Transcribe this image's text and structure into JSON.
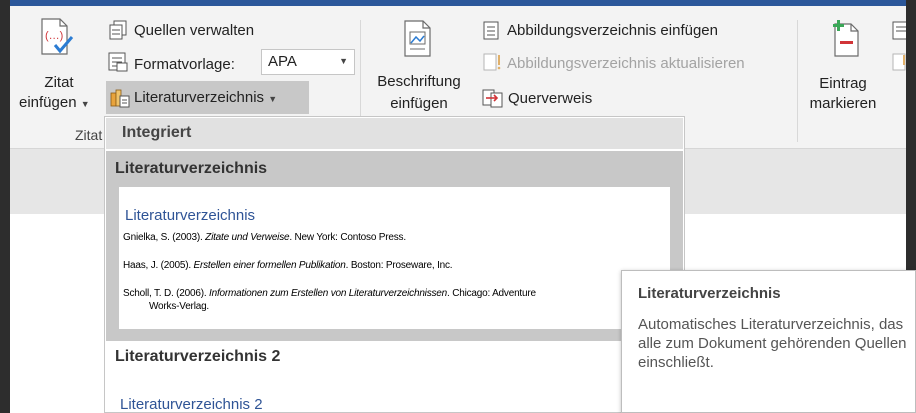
{
  "ribbon": {
    "citation_group": {
      "insert_citation": "Zitat\neinfügen",
      "insert_citation_line1": "Zitat",
      "insert_citation_line2": "einfügen",
      "manage_sources": "Quellen verwalten",
      "style_label": "Formatvorlage:",
      "style_value": "APA",
      "bibliography": "Literaturverzeichnis",
      "group_label": "Zitat"
    },
    "captions_group": {
      "insert_caption_line1": "Beschriftung",
      "insert_caption_line2": "einfügen",
      "insert_table_of_figures": "Abbildungsverzeichnis einfügen",
      "update_table": "Abbildungsverzeichnis aktualisieren",
      "cross_reference": "Querverweis"
    },
    "index_group": {
      "mark_entry_line1": "Eintrag",
      "mark_entry_line2": "markieren"
    }
  },
  "dropdown": {
    "section_header": "Integriert",
    "items": [
      {
        "title": "Literaturverzeichnis",
        "preview_heading": "Literaturverzeichnis",
        "references": [
          {
            "prefix": "Gnielka, S. (2003). ",
            "italic": "Zitate und Verweise",
            "suffix": ". New York: Contoso Press."
          },
          {
            "prefix": "Haas, J. (2005). ",
            "italic": "Erstellen einer formellen Publikation",
            "suffix": ". Boston: Proseware, Inc."
          },
          {
            "prefix": "Scholl, T. D. (2006). ",
            "italic": "Informationen zum Erstellen von Literaturverzeichnissen",
            "suffix": ". Chicago: Adventure",
            "continuation": "Works-Verlag."
          }
        ]
      },
      {
        "title": "Literaturverzeichnis 2",
        "preview_heading": "Literaturverzeichnis 2"
      }
    ]
  },
  "tooltip": {
    "title": "Literaturverzeichnis",
    "body": "Automatisches Literaturverzeichnis, das alle zum Dokument gehörenden Quellen einschließt."
  }
}
